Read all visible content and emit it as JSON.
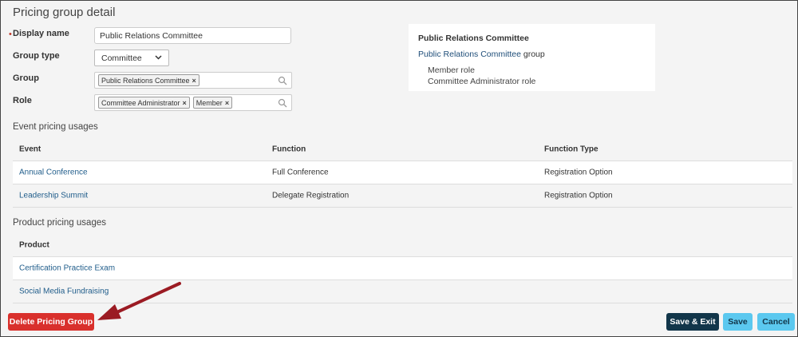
{
  "page": {
    "title": "Pricing group detail"
  },
  "form": {
    "display_name_label": "Display name",
    "display_name_value": "Public Relations Committee",
    "group_type_label": "Group type",
    "group_type_value": "Committee",
    "group_label": "Group",
    "group_tags": [
      "Public Relations Committee"
    ],
    "role_label": "Role",
    "role_tags": [
      "Committee Administrator",
      "Member"
    ]
  },
  "preview": {
    "title": "Public Relations Committee",
    "group_link": "Public Relations Committee",
    "group_suffix": " group",
    "roles": [
      "Member role",
      "Committee Administrator role"
    ]
  },
  "event_usages": {
    "heading": "Event pricing usages",
    "columns": [
      "Event",
      "Function",
      "Function Type"
    ],
    "rows": [
      {
        "event": "Annual Conference",
        "function": "Full Conference",
        "function_type": "Registration Option"
      },
      {
        "event": "Leadership Summit",
        "function": "Delegate Registration",
        "function_type": "Registration Option"
      }
    ]
  },
  "product_usages": {
    "heading": "Product pricing usages",
    "columns": [
      "Product"
    ],
    "rows": [
      {
        "product": "Certification Practice Exam"
      },
      {
        "product": "Social Media Fundraising"
      }
    ]
  },
  "actions": {
    "delete": "Delete Pricing Group",
    "save_exit": "Save & Exit",
    "save": "Save",
    "cancel": "Cancel"
  },
  "colors": {
    "delete": "#d9302c",
    "primary_dark": "#12364a",
    "primary_light": "#5bc8ef",
    "link": "#1f5c8a",
    "arrow": "#9b1b23"
  },
  "icons": {
    "search": "search-icon",
    "remove": "remove-tag-icon",
    "dropdown": "chevron-down-icon",
    "annotation": "annotation-arrow"
  }
}
